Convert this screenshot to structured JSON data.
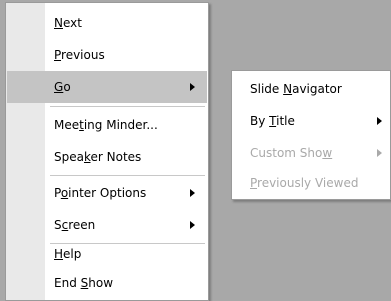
{
  "main_menu": {
    "items": [
      {
        "pre": "",
        "key": "N",
        "post": "ext"
      },
      {
        "pre": "",
        "key": "P",
        "post": "revious"
      },
      {
        "pre": "",
        "key": "G",
        "post": "o"
      },
      {
        "pre": "Mee",
        "key": "t",
        "post": "ing Minder..."
      },
      {
        "pre": "Spea",
        "key": "k",
        "post": "er Notes"
      },
      {
        "pre": "P",
        "key": "o",
        "post": "inter Options"
      },
      {
        "pre": "S",
        "key": "c",
        "post": "reen"
      },
      {
        "pre": "",
        "key": "H",
        "post": "elp"
      },
      {
        "pre": "End ",
        "key": "S",
        "post": "how"
      }
    ]
  },
  "sub_menu": {
    "items": [
      {
        "pre": "Slide ",
        "key": "N",
        "post": "avigator"
      },
      {
        "pre": "By ",
        "key": "T",
        "post": "itle"
      },
      {
        "pre": "Custom Sho",
        "key": "w",
        "post": ""
      },
      {
        "pre": "",
        "key": "P",
        "post": "reviously Viewed"
      }
    ]
  }
}
